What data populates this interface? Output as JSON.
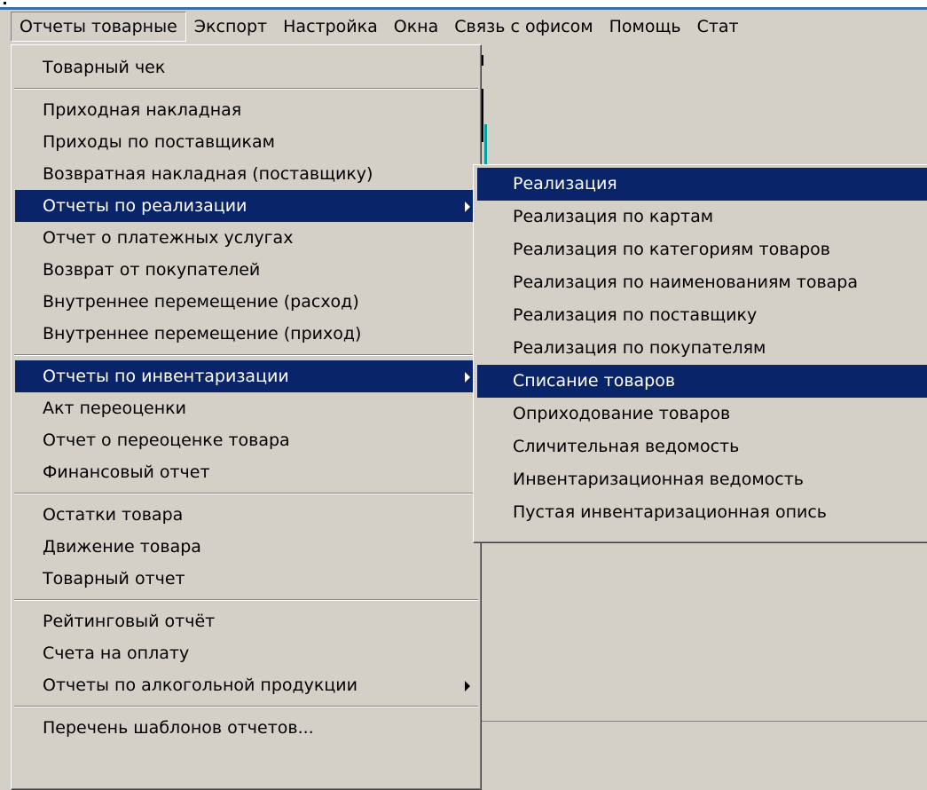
{
  "menubar": {
    "items": [
      "Отчеты товарные",
      "Экспорт",
      "Настройка",
      "Окна",
      "Связь с офисом",
      "Помощь",
      "Стат"
    ]
  },
  "main_menu": {
    "items": [
      "Товарный чек",
      "Приходная накладная",
      "Приходы по поставщикам",
      "Возвратная накладная (поставщику)",
      "Отчеты по реализации",
      "Отчет о платежных услугах",
      "Возврат от покупателей",
      "Внутреннее перемещение (расход)",
      "Внутреннее перемещение (приход)",
      "Отчеты по инвентаризации",
      "Акт переоценки",
      "Отчет о переоценке товара",
      "Финансовый отчет",
      "Остатки товара",
      "Движение товара",
      "Товарный отчет",
      "Рейтинговый отчёт",
      "Счета на оплату",
      "Отчеты по алкогольной продукции",
      "Перечень шаблонов отчетов..."
    ]
  },
  "sub_menu": {
    "items": [
      "Реализация",
      "Реализация по картам",
      "Реализация по категориям товаров",
      "Реализация по наименованиям товара",
      "Реализация по поставщику",
      "Реализация по покупателям",
      "Списание товаров",
      "Оприходование товаров",
      "Сличительная ведомость",
      "Инвентаризационная ведомость",
      "Пустая инвентаризационная опись"
    ]
  },
  "colors": {
    "highlight": "#0a246a",
    "face": "#d4d0c8",
    "titlebar": "#3a6ea5"
  }
}
